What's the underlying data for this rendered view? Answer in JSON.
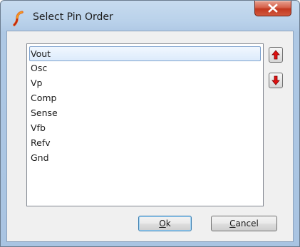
{
  "window": {
    "title": "Select Pin Order",
    "icon": "simetrix-logo-icon",
    "close_glyph": "x"
  },
  "pin_list": {
    "items": [
      "Vout",
      "Osc",
      "Vp",
      "Comp",
      "Sense",
      "Vfb",
      "Refv",
      "Gnd"
    ],
    "selected_index": 0
  },
  "buttons": {
    "move_up": "arrow-up-icon",
    "move_down": "arrow-down-icon",
    "ok_mnemonic": "O",
    "ok_rest": "k",
    "cancel_mnemonic": "C",
    "cancel_rest": "ancel"
  },
  "colors": {
    "arrow_red": "#e01010",
    "selection_border": "#7da2ce",
    "close_red": "#c2381f"
  }
}
